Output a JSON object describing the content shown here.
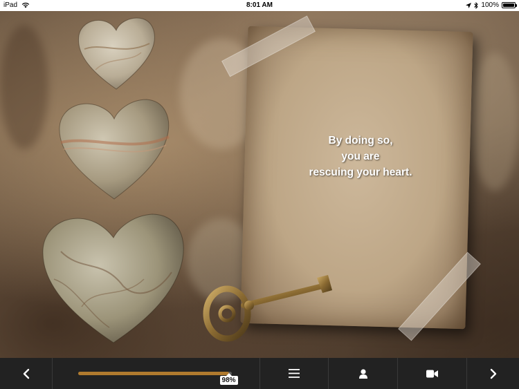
{
  "status_bar": {
    "device": "iPad",
    "time": "8:01 AM",
    "battery": "100%"
  },
  "page": {
    "lines": [
      "By doing so,",
      "you are",
      "rescuing your heart."
    ]
  },
  "toolbar": {
    "progress_label": "98%",
    "progress_value": 0.98,
    "accent_color": "#b07a2e",
    "icons": {
      "prev": "chevron-left-icon",
      "menu": "hamburger-menu-icon",
      "profile": "person-icon",
      "video": "video-camera-icon",
      "next": "chevron-right-icon"
    }
  }
}
